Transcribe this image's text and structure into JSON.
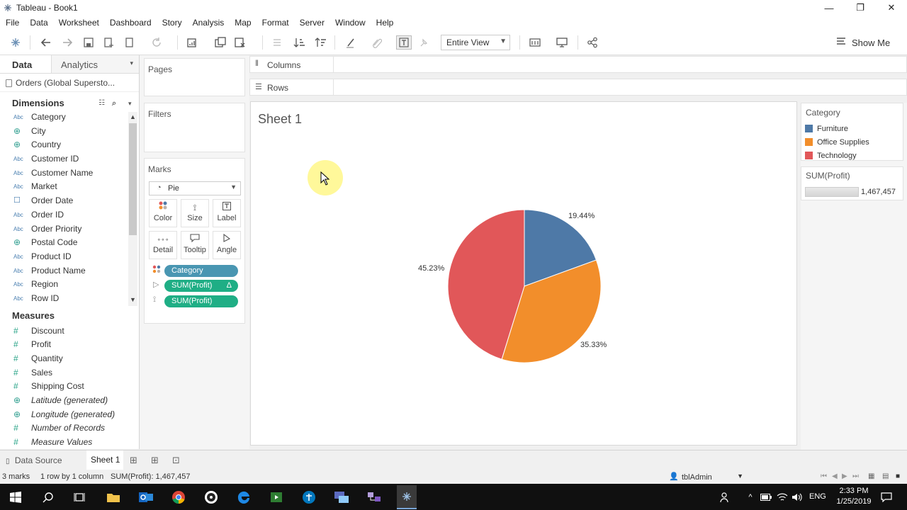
{
  "window": {
    "title": "Tableau - Book1",
    "minimize": "—",
    "restore": "❐",
    "close": "✕"
  },
  "menu": [
    "File",
    "Data",
    "Worksheet",
    "Dashboard",
    "Story",
    "Analysis",
    "Map",
    "Format",
    "Server",
    "Window",
    "Help"
  ],
  "toolbar": {
    "fit": "Entire View",
    "show_me": "Show Me"
  },
  "data_pane": {
    "data_tab": "Data",
    "analytics_tab": "Analytics",
    "datasource": "Orders (Global Supersto...",
    "dimensions_label": "Dimensions",
    "dimensions": [
      {
        "name": "Category",
        "type": "Abc"
      },
      {
        "name": "City",
        "type": "geo"
      },
      {
        "name": "Country",
        "type": "geo"
      },
      {
        "name": "Customer ID",
        "type": "Abc"
      },
      {
        "name": "Customer Name",
        "type": "Abc"
      },
      {
        "name": "Market",
        "type": "Abc"
      },
      {
        "name": "Order Date",
        "type": "date"
      },
      {
        "name": "Order ID",
        "type": "Abc"
      },
      {
        "name": "Order Priority",
        "type": "Abc"
      },
      {
        "name": "Postal Code",
        "type": "geo"
      },
      {
        "name": "Product ID",
        "type": "Abc"
      },
      {
        "name": "Product Name",
        "type": "Abc"
      },
      {
        "name": "Region",
        "type": "Abc"
      },
      {
        "name": "Row ID",
        "type": "Abc"
      }
    ],
    "measures_label": "Measures",
    "measures": [
      {
        "name": "Discount",
        "type": "meas"
      },
      {
        "name": "Profit",
        "type": "meas"
      },
      {
        "name": "Quantity",
        "type": "meas"
      },
      {
        "name": "Sales",
        "type": "meas"
      },
      {
        "name": "Shipping Cost",
        "type": "meas"
      },
      {
        "name": "Latitude (generated)",
        "type": "geo"
      },
      {
        "name": "Longitude (generated)",
        "type": "geo"
      },
      {
        "name": "Number of Records",
        "type": "meas"
      },
      {
        "name": "Measure Values",
        "type": "meas"
      }
    ]
  },
  "cards": {
    "pages": "Pages",
    "filters": "Filters",
    "marks": "Marks",
    "mark_type": "Pie",
    "buttons": {
      "color": "Color",
      "size": "Size",
      "label": "Label",
      "detail": "Detail",
      "tooltip": "Tooltip",
      "angle": "Angle"
    },
    "pills": [
      "Category",
      "SUM(Profit)",
      "SUM(Profit)"
    ],
    "pill_delta": "Δ"
  },
  "shelves": {
    "columns": "Columns",
    "rows": "Rows"
  },
  "sheet": {
    "title": "Sheet 1"
  },
  "chart_data": {
    "type": "pie",
    "categories": [
      "Furniture",
      "Office Supplies",
      "Technology"
    ],
    "values": [
      19.44,
      35.33,
      45.23
    ],
    "labels": [
      "19.44%",
      "35.33%",
      "45.23%"
    ],
    "colors": [
      "#4e79a7",
      "#f28e2b",
      "#e15759"
    ]
  },
  "legend": {
    "title": "Category",
    "items": [
      {
        "label": "Furniture",
        "color": "#4e79a7"
      },
      {
        "label": "Office Supplies",
        "color": "#f28e2b"
      },
      {
        "label": "Technology",
        "color": "#e15759"
      }
    ],
    "size_title": "SUM(Profit)",
    "size_value": "1,467,457"
  },
  "tabs": {
    "data_source": "Data Source",
    "sheet1": "Sheet 1"
  },
  "status": {
    "marks": "3 marks",
    "rows": "1 row by 1 column",
    "sum": "SUM(Profit): 1,467,457",
    "user": "tblAdmin"
  },
  "taskbar": {
    "time": "2:33 PM",
    "date": "1/25/2019",
    "lang": "ENG"
  }
}
